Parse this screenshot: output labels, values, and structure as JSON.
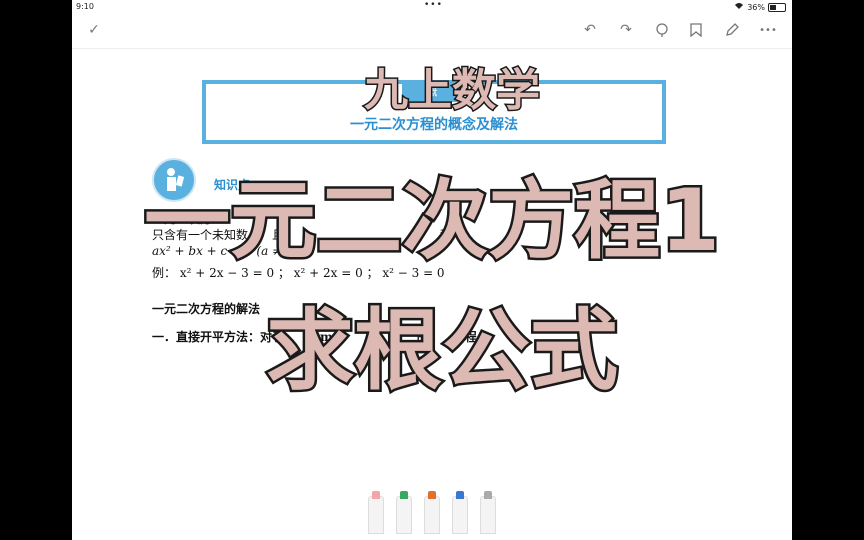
{
  "status": {
    "time": "9:10",
    "dots": "•••",
    "battery": "36%"
  },
  "toolbar": {
    "done": "✓",
    "undo": "↶",
    "redo": "↷",
    "more": "•••"
  },
  "document": {
    "tab_label": "概",
    "subtitle": "一元二次方程的概念及解法",
    "kp_label": "知识点",
    "lines": [
      "一元二次方",
      "只含有一个未知数　　且　　　　　　　　　　　　　程",
      "ax² + bx + c = 0 (a ≠ 0)",
      "例： x² + 2x − 3 = 0 ； x² + 2x = 0 ； x² − 3 = 0",
      "一元二次方程的解法",
      "一．直接开平方法：对于　　　m　　　　　　　的　　　程"
    ]
  },
  "overlay": {
    "line1": "九上数学",
    "line2": "一元二次方程1",
    "line3": "求根公式"
  },
  "pens": [
    "#f5a5a5",
    "#3aa860",
    "#e07030",
    "#3a78d0",
    "#aaaaaa"
  ]
}
